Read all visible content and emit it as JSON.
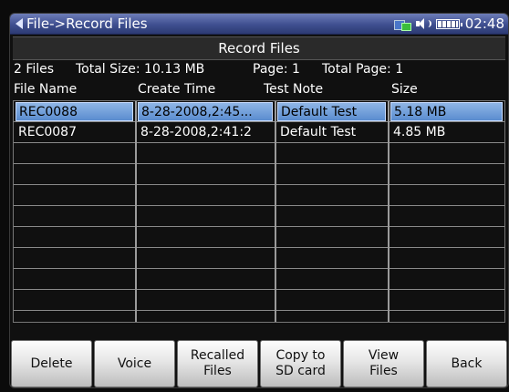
{
  "titlebar": {
    "title": "File->Record Files",
    "clock": "02:48",
    "icons": [
      "back-arrow-icon",
      "usb-icon",
      "speaker-icon",
      "battery-icon"
    ]
  },
  "header": {
    "label": "Record Files"
  },
  "info": {
    "file_count": "2 Files",
    "total_size": "Total Size: 10.13 MB",
    "page": "Page: 1",
    "total_page": "Total Page: 1"
  },
  "columns": {
    "name": "File Name",
    "time": "Create Time",
    "note": "Test Note",
    "size": "Size"
  },
  "rows": [
    {
      "name": "REC0088",
      "time": "8-28-2008,2:45...",
      "note": "Default Test",
      "size": "5.18 MB",
      "selected": true
    },
    {
      "name": "REC0087",
      "time": "8-28-2008,2:41:2",
      "note": "Default Test",
      "size": "4.85 MB",
      "selected": false
    }
  ],
  "softkeys": {
    "delete": "Delete",
    "voice": "Voice",
    "recalled_line1": "Recalled",
    "recalled_line2": "Files",
    "copy_line1": "Copy to",
    "copy_line2": "SD card",
    "view_line1": "View",
    "view_line2": "Files",
    "back": "Back"
  },
  "colors": {
    "titlebar": "#3f4f90",
    "selection": "#7aa6de",
    "background": "#101010"
  }
}
